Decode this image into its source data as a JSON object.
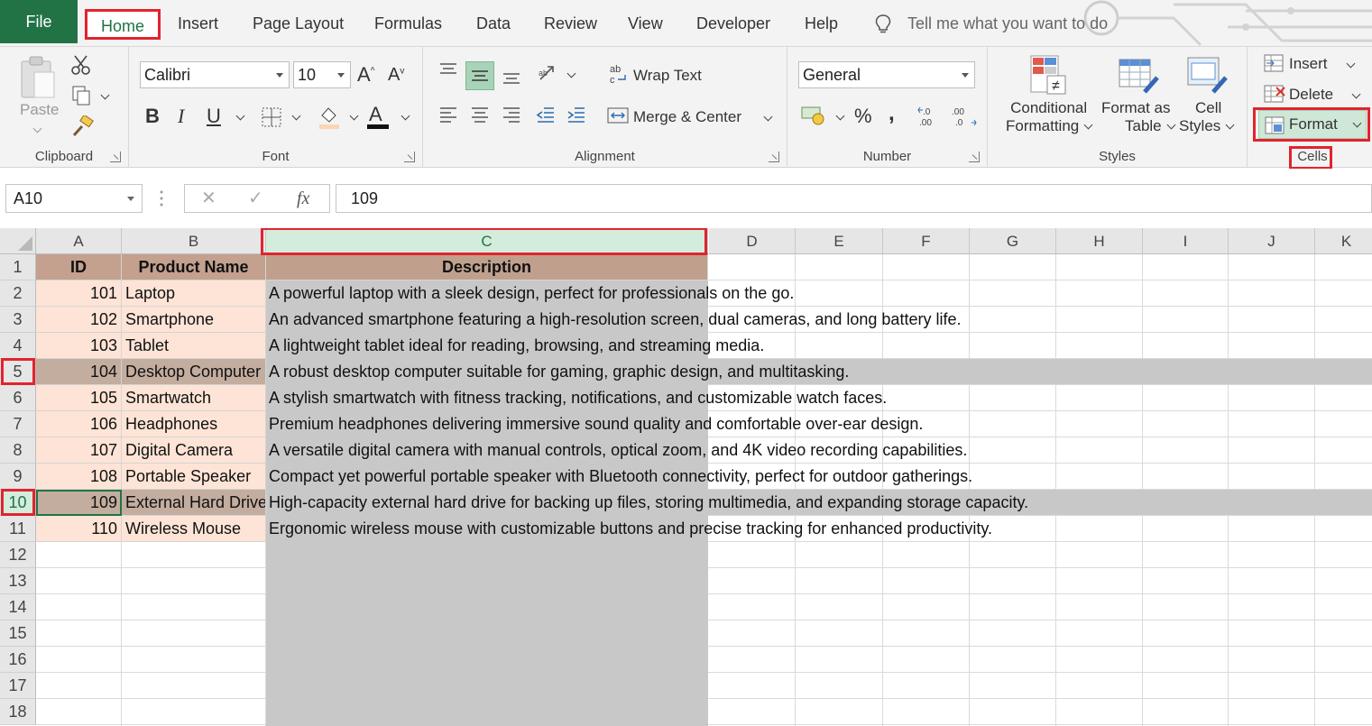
{
  "tabs": {
    "file": "File",
    "home": "Home",
    "insert": "Insert",
    "page_layout": "Page Layout",
    "formulas": "Formulas",
    "data": "Data",
    "review": "Review",
    "view": "View",
    "developer": "Developer",
    "help": "Help",
    "tell_me": "Tell me what you want to do"
  },
  "ribbon": {
    "clipboard": {
      "label": "Clipboard",
      "paste": "Paste"
    },
    "font": {
      "label": "Font",
      "font_name": "Calibri",
      "font_size": "10"
    },
    "alignment": {
      "label": "Alignment",
      "wrap_text": "Wrap Text",
      "merge_center": "Merge & Center"
    },
    "number": {
      "label": "Number",
      "format": "General",
      "percent": "%",
      "comma": ","
    },
    "styles": {
      "label": "Styles",
      "conditional_line1": "Conditional",
      "conditional_line2": "Formatting",
      "format_as_line1": "Format as",
      "format_as_line2": "Table",
      "cell_styles_line1": "Cell",
      "cell_styles_line2": "Styles"
    },
    "cells": {
      "label": "Cells",
      "insert": "Insert",
      "delete": "Delete",
      "format": "Format"
    }
  },
  "formula_bar": {
    "name_box": "A10",
    "fx": "fx",
    "value": "109"
  },
  "columns": [
    "A",
    "B",
    "C",
    "D",
    "E",
    "F",
    "G",
    "H",
    "I",
    "J",
    "K"
  ],
  "rows": [
    "1",
    "2",
    "3",
    "4",
    "5",
    "6",
    "7",
    "8",
    "9",
    "10",
    "11",
    "12",
    "13",
    "14",
    "15",
    "16",
    "17",
    "18"
  ],
  "table": {
    "headers": {
      "id": "ID",
      "name": "Product Name",
      "desc": "Description"
    },
    "data": [
      {
        "id": "101",
        "name": "Laptop",
        "desc": "A powerful laptop with a sleek design, perfect for professionals on the go."
      },
      {
        "id": "102",
        "name": "Smartphone",
        "desc": "An advanced smartphone featuring a high-resolution screen, dual cameras, and long battery life."
      },
      {
        "id": "103",
        "name": "Tablet",
        "desc": "A lightweight tablet ideal for reading, browsing, and streaming media."
      },
      {
        "id": "104",
        "name": "Desktop Computer",
        "desc": "A robust desktop computer suitable for gaming, graphic design, and multitasking."
      },
      {
        "id": "105",
        "name": "Smartwatch",
        "desc": "A stylish smartwatch with fitness tracking, notifications, and customizable watch faces."
      },
      {
        "id": "106",
        "name": "Headphones",
        "desc": "Premium headphones delivering immersive sound quality and comfortable over-ear design."
      },
      {
        "id": "107",
        "name": "Digital Camera",
        "desc": "A versatile digital camera with manual controls, optical zoom, and 4K video recording capabilities."
      },
      {
        "id": "108",
        "name": "Portable Speaker",
        "desc": "Compact yet powerful portable speaker with Bluetooth connectivity, perfect for outdoor gatherings."
      },
      {
        "id": "109",
        "name": "External Hard Drive",
        "desc": "High-capacity external hard drive for backing up files, storing multimedia, and expanding storage capacity."
      },
      {
        "id": "110",
        "name": "Wireless Mouse",
        "desc": "Ergonomic wireless mouse with customizable buttons and precise tracking for enhanced productivity."
      }
    ]
  },
  "colors": {
    "accent": "#217346",
    "highlight": "#e2232e",
    "header_fill": "#c3a18e",
    "data_fill": "#fde4d6",
    "selection_gray": "#c8c8c8"
  }
}
